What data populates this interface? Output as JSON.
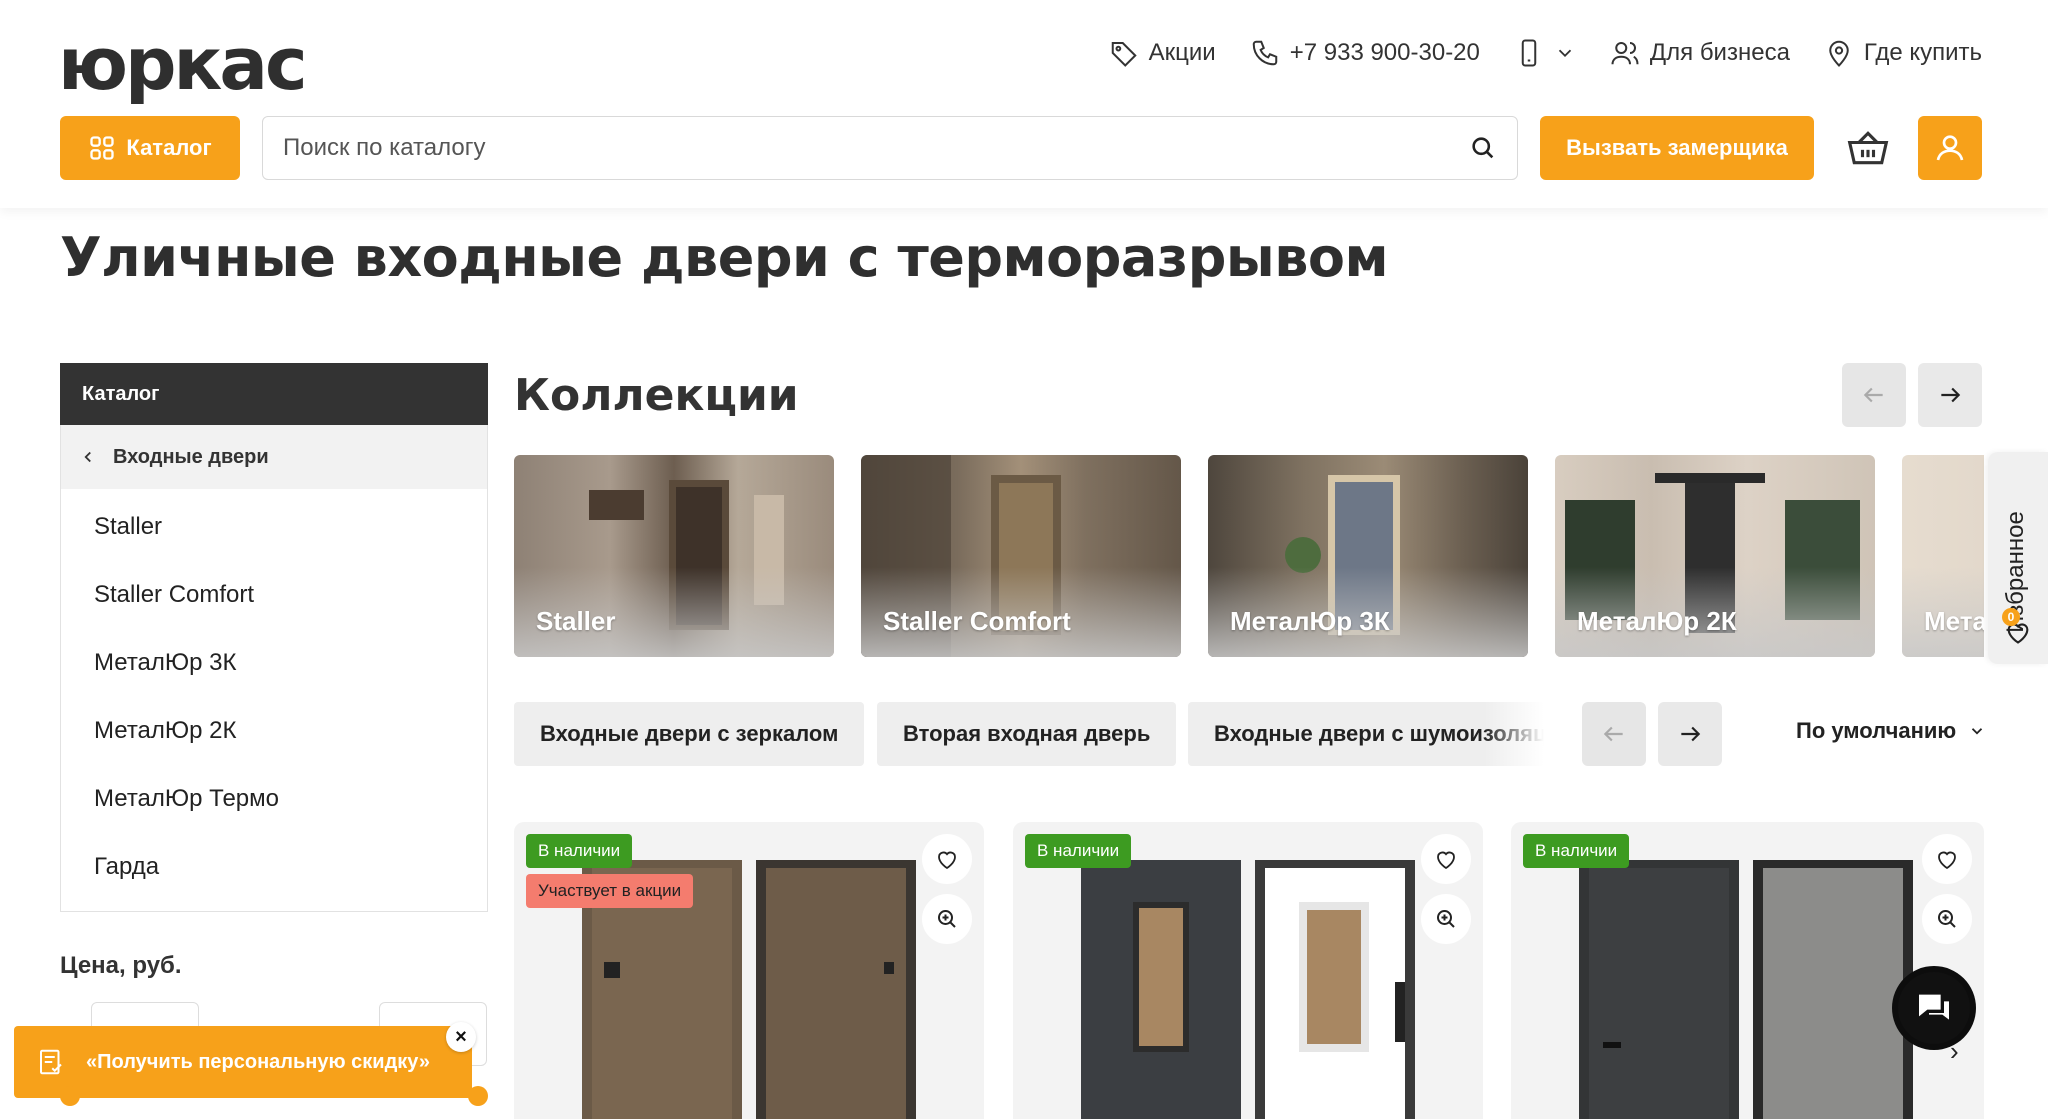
{
  "logo": {
    "text": "юркас"
  },
  "topnav": {
    "promo_label": "Акции",
    "phone": "+7 933 900-30-20",
    "business_label": "Для бизнеса",
    "where_buy_label": "Где купить"
  },
  "catalog_button": {
    "label": "Каталог"
  },
  "search": {
    "placeholder": "Поиск по каталогу",
    "value": ""
  },
  "measure_button": {
    "label": "Вызвать замерщика"
  },
  "page_title": "Уличные входные двери с терморазрывом",
  "sidebar": {
    "header": "Каталог",
    "back_label": "Входные двери",
    "items": [
      {
        "label": "Staller"
      },
      {
        "label": "Staller Comfort"
      },
      {
        "label": "МеталЮр 3К"
      },
      {
        "label": "МеталЮр 2К"
      },
      {
        "label": "МеталЮр Термо"
      },
      {
        "label": "Гарда"
      }
    ],
    "price_label": "Цена, руб."
  },
  "collections": {
    "title": "Коллекции",
    "items": [
      {
        "label": "Staller"
      },
      {
        "label": "Staller Comfort"
      },
      {
        "label": "МеталЮр 3К"
      },
      {
        "label": "МеталЮр 2К"
      },
      {
        "label": "Мета"
      }
    ]
  },
  "favorites": {
    "label": "Избранное",
    "count": "0"
  },
  "tags": {
    "items": [
      {
        "label": "Входные двери с зеркалом"
      },
      {
        "label": "Вторая входная дверь"
      },
      {
        "label": "Входные двери с шумоизоляцией"
      }
    ]
  },
  "sort": {
    "label": "По умолчанию"
  },
  "products": [
    {
      "badge_stock": "В наличии",
      "badge_promo": "Участвует в акции"
    },
    {
      "badge_stock": "В наличии"
    },
    {
      "badge_stock": "В наличии"
    }
  ],
  "promo": {
    "label": "«Получить персональную скидку»"
  },
  "colors": {
    "accent": "#f7a11a",
    "dark": "#333333",
    "in_stock": "#3d9b21",
    "promo_badge": "#f47c6e"
  }
}
